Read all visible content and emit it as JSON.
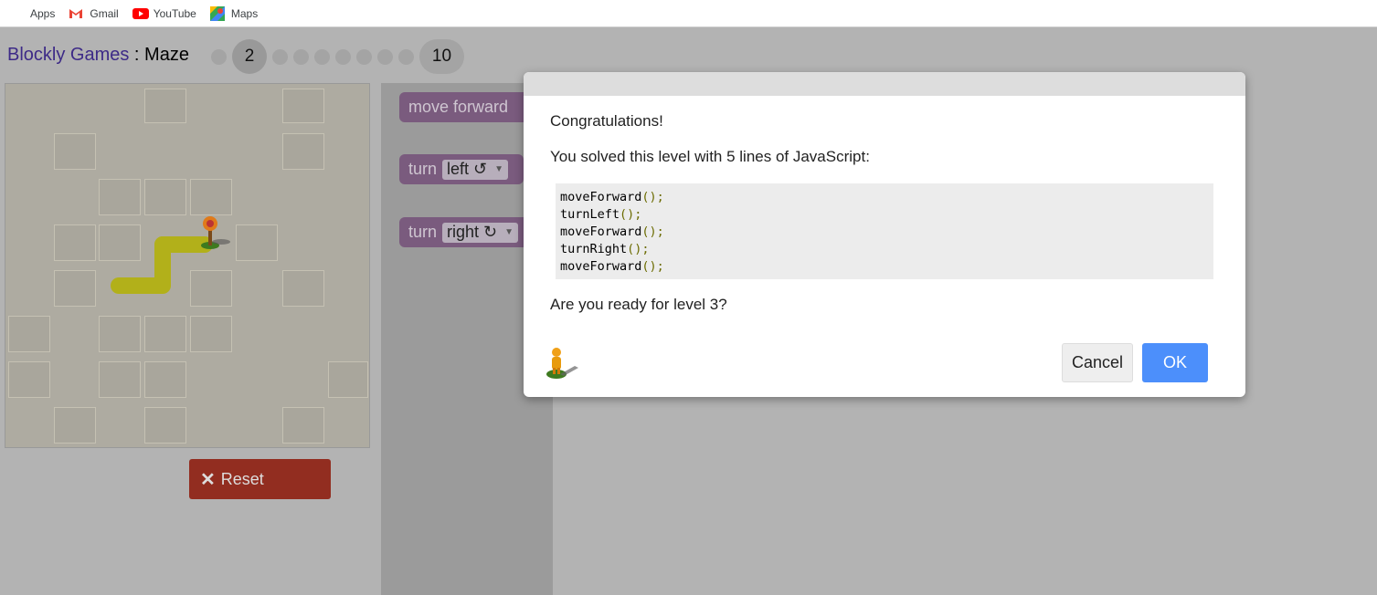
{
  "bookmarks": [
    {
      "label": "Apps",
      "icon": "apps-grid-icon"
    },
    {
      "label": "Gmail",
      "icon": "gmail-icon"
    },
    {
      "label": "YouTube",
      "icon": "youtube-icon"
    },
    {
      "label": "Maps",
      "icon": "maps-icon"
    }
  ],
  "header": {
    "brand": "Blockly Games",
    "separator": " : ",
    "game": "Maze",
    "current_level": "2",
    "last_level": "10"
  },
  "reset_label": "Reset",
  "blocks": {
    "move_forward": "move forward",
    "turn1": "turn",
    "turn1_option": "left ↺",
    "turn2": "turn",
    "turn2_option": "right ↻"
  },
  "dialog": {
    "heading": "Congratulations!",
    "message": "You solved this level with 5 lines of JavaScript:",
    "code_lines": [
      {
        "name": "moveForward",
        "paren": "();"
      },
      {
        "name": "turnLeft",
        "paren": "();"
      },
      {
        "name": "moveForward",
        "paren": "();"
      },
      {
        "name": "turnRight",
        "paren": "();"
      },
      {
        "name": "moveForward",
        "paren": "();"
      }
    ],
    "question": "Are you ready for level 3?",
    "cancel_label": "Cancel",
    "ok_label": "OK"
  },
  "colors": {
    "ok_button": "#4c8ffb",
    "reset_button": "#922d20",
    "block": "#7a5b7e",
    "path": "#b2b01a"
  }
}
